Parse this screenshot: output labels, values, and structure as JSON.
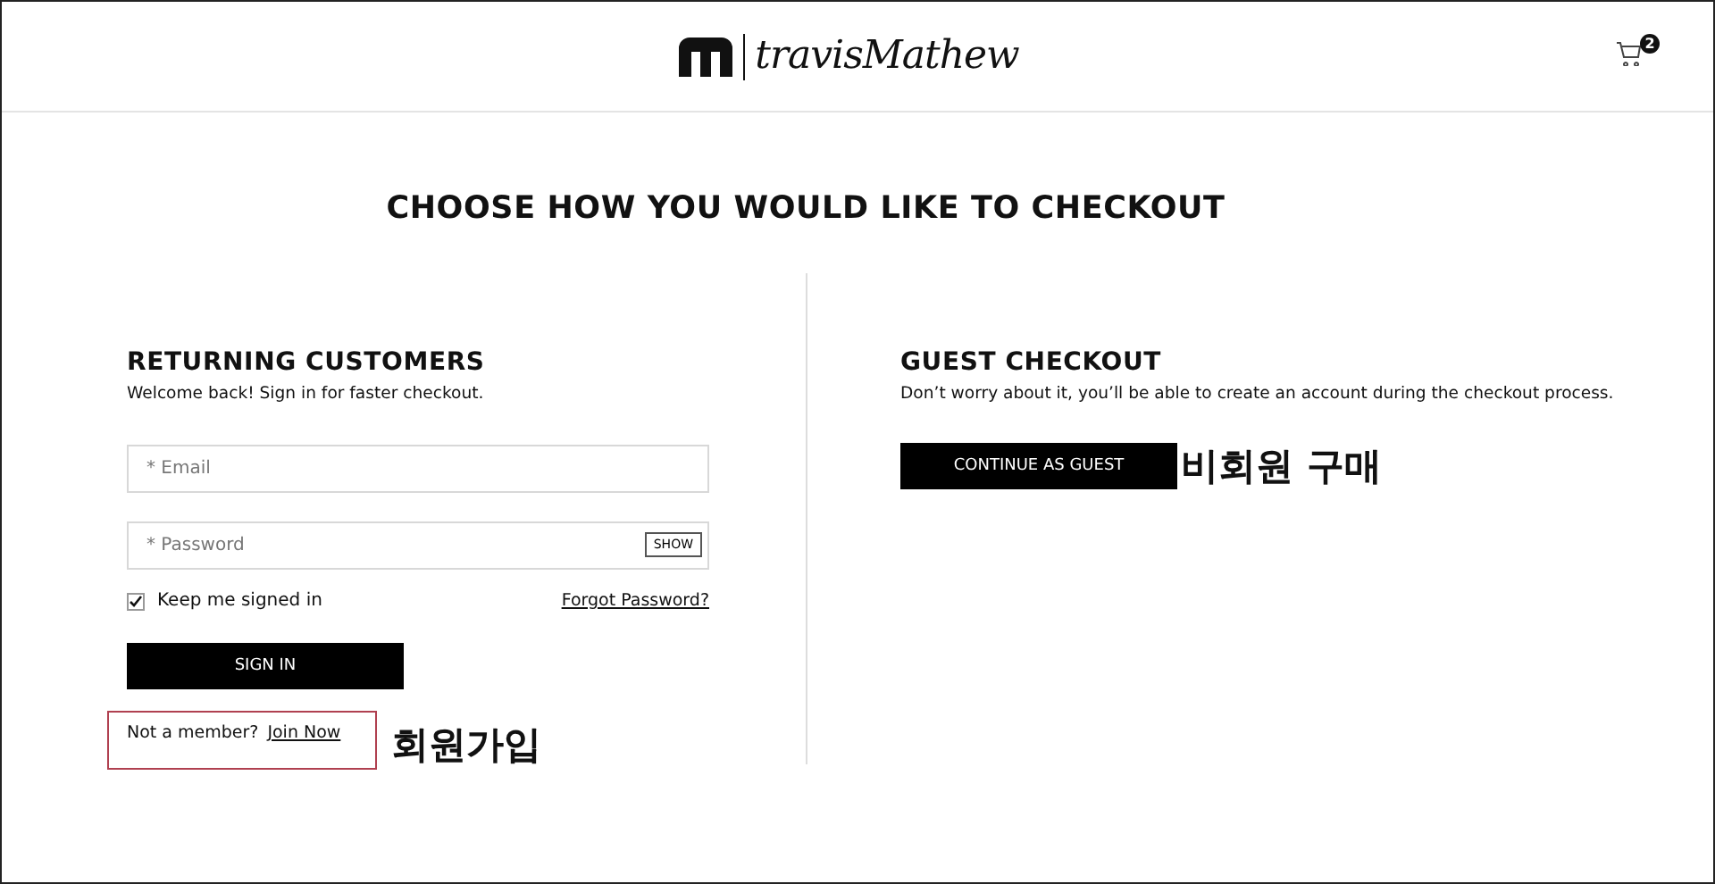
{
  "header": {
    "brand": "travisMathew",
    "cart_count": "2"
  },
  "title": "CHOOSE HOW YOU WOULD LIKE TO CHECKOUT",
  "returning": {
    "heading": "RETURNING CUSTOMERS",
    "subtitle": "Welcome back! Sign in for faster checkout.",
    "email": {
      "placeholder": "* Email"
    },
    "password": {
      "placeholder": "* Password",
      "toggle": "SHOW"
    },
    "remember": {
      "label": "Keep me signed in",
      "checked": true
    },
    "forgot": "Forgot Password?",
    "submit": "SIGN IN",
    "join_prompt": "Not a member?",
    "join_link": "Join Now",
    "annotation": "회원가입"
  },
  "guest": {
    "heading": "GUEST CHECKOUT",
    "subtitle": "Don’t worry about it, you’ll be able to create an account during the checkout process.",
    "button": "CONTINUE AS GUEST",
    "annotation": "비회원 구매"
  }
}
